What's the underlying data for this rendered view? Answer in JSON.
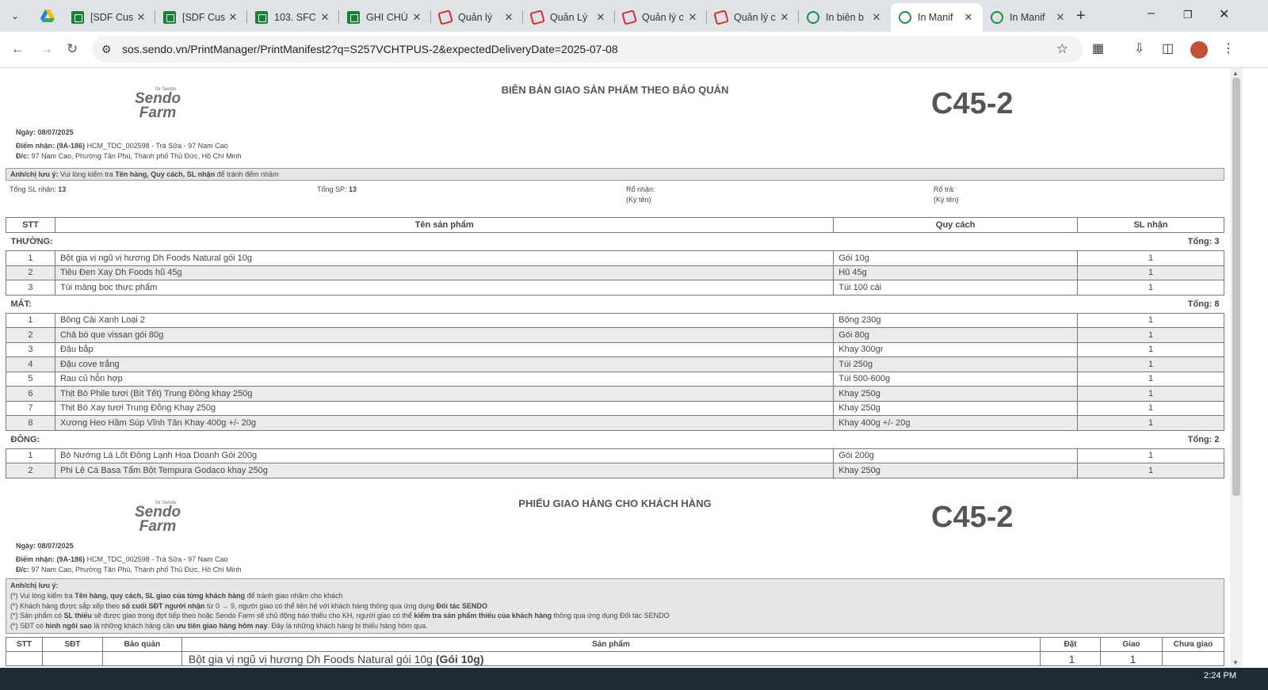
{
  "browser": {
    "tabs": [
      {
        "title": "[SDF Cus",
        "icon": "sheets-icon"
      },
      {
        "title": "[SDF Cus",
        "icon": "sheets-icon"
      },
      {
        "title": "103. SFC",
        "icon": "sheets-icon"
      },
      {
        "title": "GHI CHÚ",
        "icon": "sheets-icon"
      },
      {
        "title": "Quản lý",
        "icon": "sendo-icon"
      },
      {
        "title": "Quản Lý",
        "icon": "sendo-icon"
      },
      {
        "title": "Quản lý c",
        "icon": "sendo-icon"
      },
      {
        "title": "Quản lý c",
        "icon": "sendo-icon"
      },
      {
        "title": "In biên b",
        "icon": "globe-icon"
      },
      {
        "title": "In Manif",
        "icon": "globe-icon",
        "active": true
      },
      {
        "title": "In Manif",
        "icon": "globe-icon"
      }
    ],
    "url": "sos.sendo.vn/PrintManager/PrintManifest2?q=S257VCHTPUS-2&expectedDeliveryDate=2025-07-08",
    "time": "2:24 PM"
  },
  "logo": {
    "top": "for Sendo",
    "line1": "Sendo",
    "line2": "Farm"
  },
  "manifest": {
    "title": "BIÊN BẢN GIAO SẢN PHẨM THEO BẢO QUẢN",
    "code": "C45-2",
    "date_label": "Ngày:",
    "date": "08/07/2025",
    "pickup_label": "Điểm nhận:",
    "pickup_code": "(9A-186)",
    "pickup": "HCM_TDC_002598 - Trà Sữa - 97 Nam Cao",
    "address_label": "Đ/c:",
    "address": "97 Nam Cao, Phường Tân Phú, Thành phố Thủ Đức, Hồ Chí Minh",
    "note_label": "Anh/chị lưu ý:",
    "note_pre": "Vui lòng kiểm tra",
    "note_bold": "Tên hàng, Quy cách, SL nhận",
    "note_post": "để tránh đếm nhầm",
    "total_received_label": "Tổng SL nhận:",
    "total_received": "13",
    "total_sp_label": "Tổng SP:",
    "total_sp": "13",
    "basket_in": "Rổ nhận:",
    "basket_out": "Rổ trả:",
    "sign": "(Ký tên)",
    "headers": {
      "stt": "STT",
      "name": "Tên sản phẩm",
      "spec": "Quy cách",
      "qty": "SL nhận"
    },
    "groups": [
      {
        "name": "THƯỜNG:",
        "total": "Tổng: 3",
        "items": [
          {
            "stt": "1",
            "name": "Bột gia vị ngũ vị hương Dh Foods Natural gói 10g",
            "spec": "Gói 10g",
            "qty": "1"
          },
          {
            "stt": "2",
            "name": "Tiêu Đen Xay Dh Foods hũ 45g",
            "spec": "Hũ 45g",
            "qty": "1"
          },
          {
            "stt": "3",
            "name": "Túi màng bọc thực phẩm",
            "spec": "Túi 100 cái",
            "qty": "1"
          }
        ]
      },
      {
        "name": "MÁT:",
        "total": "Tổng: 8",
        "items": [
          {
            "stt": "1",
            "name": "Bông Cải Xanh Loại 2",
            "spec": "Bông 230g",
            "qty": "1"
          },
          {
            "stt": "2",
            "name": "Chả bò que vissan gói 80g",
            "spec": "Gói 80g",
            "qty": "1"
          },
          {
            "stt": "3",
            "name": "Đậu bắp",
            "spec": "Khay 300gr",
            "qty": "1"
          },
          {
            "stt": "4",
            "name": "Đậu cove trắng",
            "spec": "Túi 250g",
            "qty": "1"
          },
          {
            "stt": "5",
            "name": "Rau củ hỗn hợp",
            "spec": "Túi 500-600g",
            "qty": "1"
          },
          {
            "stt": "6",
            "name": "Thịt Bò Phile tươi (Bít Tết) Trung Đồng khay 250g",
            "spec": "Khay 250g",
            "qty": "1"
          },
          {
            "stt": "7",
            "name": "Thịt Bò Xay tươi Trung Đồng Khay 250g",
            "spec": "Khay 250g",
            "qty": "1"
          },
          {
            "stt": "8",
            "name": "Xương Heo Hầm Súp Vĩnh Tân Khay 400g +/- 20g",
            "spec": "Khay 400g +/- 20g",
            "qty": "1"
          }
        ]
      },
      {
        "name": "ĐÔNG:",
        "total": "Tổng: 2",
        "items": [
          {
            "stt": "1",
            "name": "Bò Nướng Lá Lốt Đông Lạnh Hoa Doanh Gói 200g",
            "spec": "Gói 200g",
            "qty": "1"
          },
          {
            "stt": "2",
            "name": "Phi Lê Cá Basa Tẩm Bột Tempura Godaco khay 250g",
            "spec": "Khay 250g",
            "qty": "1"
          }
        ]
      }
    ]
  },
  "delivery": {
    "title": "PHIẾU GIAO HÀNG CHO KHÁCH HÀNG",
    "code": "C45-2",
    "date_label": "Ngày:",
    "date": "08/07/2025",
    "pickup_label": "Điểm nhận:",
    "pickup_code": "(9A-186)",
    "pickup": "HCM_TDC_002598 - Trà Sữa - 97 Nam Cao",
    "address_label": "Đ/c:",
    "address": "97 Nam Cao, Phường Tân Phú, Thành phố Thủ Đức, Hồ Chí Minh",
    "note_label": "Anh/chị lưu ý:",
    "notes": [
      {
        "a": "(*) Vui lòng kiểm tra ",
        "b": "Tên hàng, quy cách, SL giao của từng khách hàng",
        "c": " để tránh giao nhầm cho khách",
        "d": "",
        "e": ""
      },
      {
        "a": "(*) Khách hàng được sắp xếp theo ",
        "b": "số cuối SĐT người nhận",
        "c": " từ 0 → 9, người giao có thể liên hệ với khách hàng thông qua ứng dụng ",
        "d": "Đối tác SENDO",
        "e": ""
      },
      {
        "a": "(*) Sản phẩm có ",
        "b": "SL thiếu",
        "c": " sẽ được giao trong đợt tiếp theo hoặc Sendo Farm sẽ chủ động báo thiếu cho KH, người giao có thể ",
        "d": "kiểm tra sản phẩm thiếu của khách hàng",
        "e": " thông qua ứng dụng Đối tác SENDO"
      },
      {
        "a": "(*) SĐT có ",
        "b": "hình ngôi sao",
        "c": " là những khách hàng cần ",
        "d": "ưu tiên giao hàng hôm nay",
        "e": ". Đây là những khách hàng bị thiếu hàng hôm qua."
      }
    ],
    "headers": {
      "stt": "STT",
      "phone": "SĐT",
      "storage": "Bảo quản",
      "product": "Sản phẩm",
      "ordered": "Đặt",
      "delivered": "Giao",
      "pending": "Chưa giao"
    },
    "first_row": {
      "product": "Bột gia vị ngũ vị hương Dh Foods Natural gói 10g",
      "spec": "(Gói 10g)",
      "ordered": "1",
      "delivered": "1"
    }
  }
}
